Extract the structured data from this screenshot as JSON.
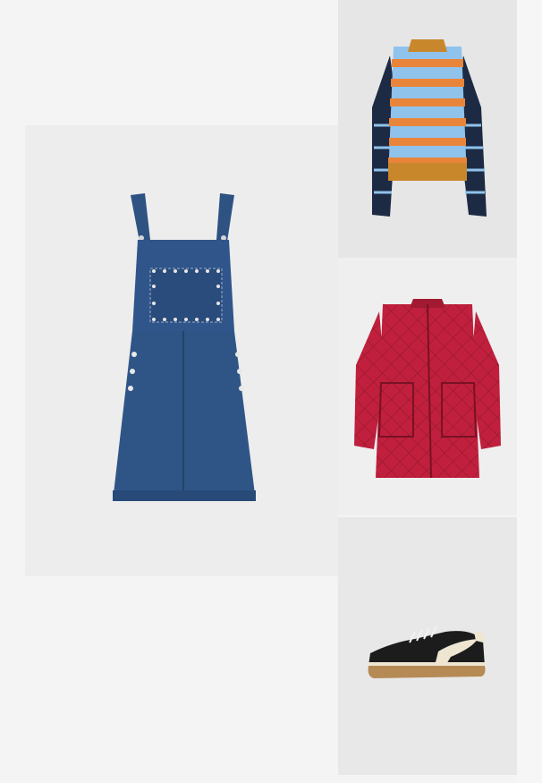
{
  "outfit": {
    "items": [
      {
        "id": "dress",
        "icon": "denim-pinafore-dress-image",
        "color": "#2f5586"
      },
      {
        "id": "sweater",
        "icon": "striped-knit-sweater-image",
        "color": "#8fc3ec"
      },
      {
        "id": "jacket",
        "icon": "quilted-red-jacket-image",
        "color": "#c0203d"
      },
      {
        "id": "sneaker",
        "icon": "black-cream-sneaker-image",
        "color": "#1c1c1c"
      }
    ]
  }
}
